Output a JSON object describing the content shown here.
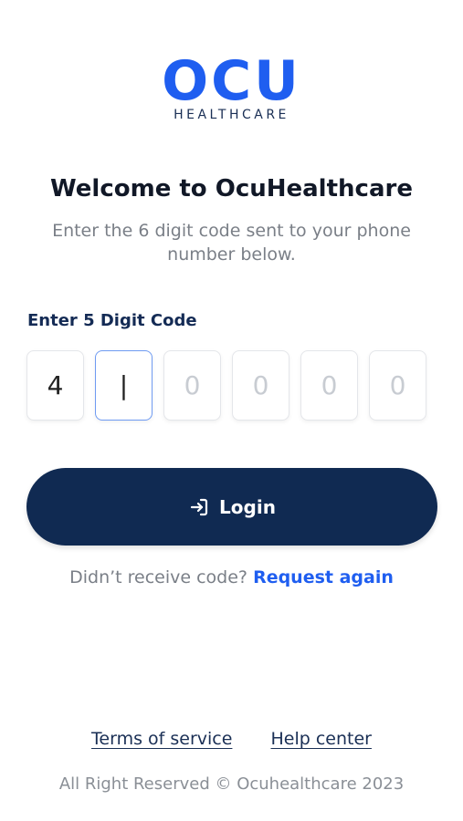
{
  "logo": {
    "mark": "OCU",
    "sub": "HEALTHCARE"
  },
  "title": "Welcome to OcuHealthcare",
  "subtitle": "Enter the 6 digit code sent to your phone number below.",
  "code": {
    "label": "Enter 5 Digit Code",
    "digits": [
      "4",
      "|",
      "0",
      "0",
      "0",
      "0"
    ]
  },
  "login": {
    "label": "Login",
    "icon": "login-arrow-icon"
  },
  "resend": {
    "prompt": "Didn’t receive code?",
    "link": "Request again"
  },
  "footer": {
    "terms": "Terms of service",
    "help": "Help center",
    "copyright": "All Right Reserved © Ocuhealthcare 2023"
  },
  "colors": {
    "brand_blue": "#1f5ef0",
    "navy": "#102a52",
    "muted_text": "#7a7f87"
  }
}
